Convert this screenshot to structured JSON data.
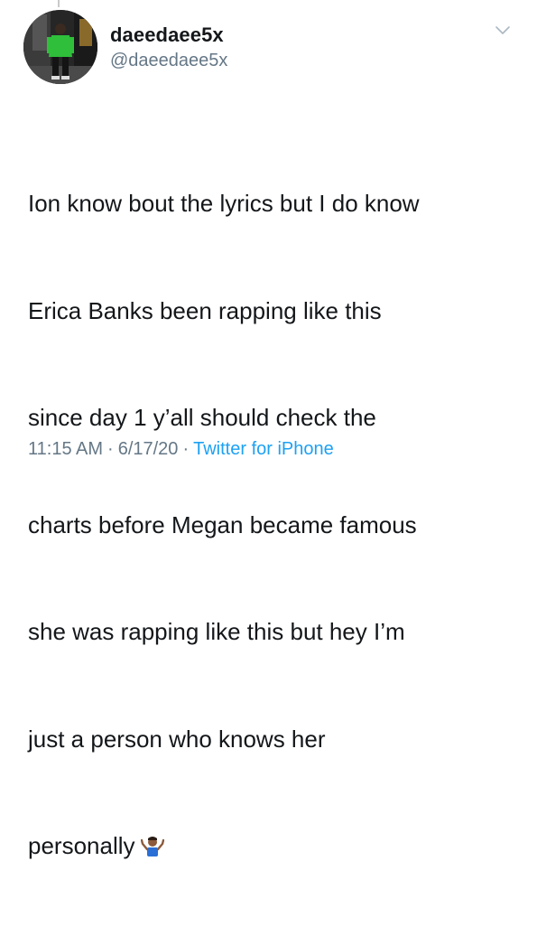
{
  "user": {
    "display_name": "daeedaee5x",
    "handle": "@daeedaee5x",
    "avatar_icon": "profile-photo"
  },
  "tweet": {
    "lines": [
      "Ion know bout the lyrics but I do know",
      "Erica Banks been rapping like this",
      "since day 1 y’all should check the",
      "charts before Megan became famous",
      "she was rapping like this but hey I’m",
      "just a person who knows her",
      "personally"
    ],
    "emoji_icon": "person-shrugging-emoji"
  },
  "meta": {
    "time": "11:15 AM",
    "separator": "·",
    "date": "6/17/20",
    "source": "Twitter for iPhone"
  },
  "colors": {
    "text": "#14171a",
    "secondary": "#657786",
    "link": "#1da1f2",
    "background": "#ffffff"
  },
  "icons": {
    "menu": "chevron-down-icon"
  }
}
